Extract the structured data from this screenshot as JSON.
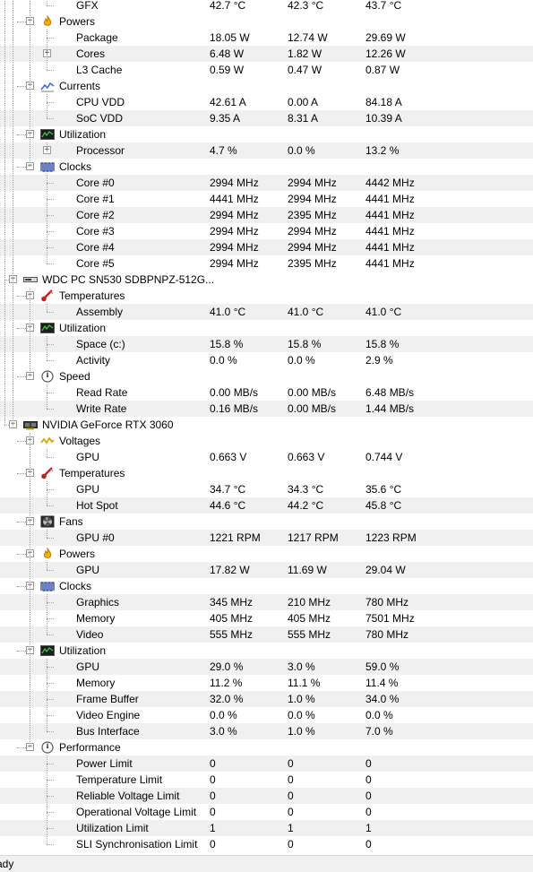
{
  "tree": [
    {
      "kind": "leaf",
      "depth": 3,
      "label": "GFX",
      "v": [
        "42.7 °C",
        "42.3 °C",
        "43.7 °C"
      ]
    },
    {
      "kind": "group",
      "depth": 2,
      "icon": "flame",
      "label": "Powers"
    },
    {
      "kind": "leaf",
      "depth": 3,
      "label": "Package",
      "v": [
        "18.05 W",
        "12.74 W",
        "29.69 W"
      ]
    },
    {
      "kind": "leaf",
      "depth": 3,
      "label": "Cores",
      "expander": true,
      "v": [
        "6.48 W",
        "1.82 W",
        "12.26 W"
      ]
    },
    {
      "kind": "leaf",
      "depth": 3,
      "label": "L3 Cache",
      "v": [
        "0.59 W",
        "0.47 W",
        "0.87 W"
      ]
    },
    {
      "kind": "group",
      "depth": 2,
      "icon": "current",
      "label": "Currents"
    },
    {
      "kind": "leaf",
      "depth": 3,
      "label": "CPU VDD",
      "v": [
        "42.61 A",
        "0.00 A",
        "84.18 A"
      ]
    },
    {
      "kind": "leaf",
      "depth": 3,
      "label": "SoC VDD",
      "v": [
        "9.35 A",
        "8.31 A",
        "10.39 A"
      ]
    },
    {
      "kind": "group",
      "depth": 2,
      "icon": "monitor",
      "label": "Utilization"
    },
    {
      "kind": "leaf",
      "depth": 3,
      "label": "Processor",
      "expander": true,
      "v": [
        "4.7 %",
        "0.0 %",
        "13.2 %"
      ]
    },
    {
      "kind": "group",
      "depth": 2,
      "icon": "clock",
      "label": "Clocks"
    },
    {
      "kind": "leaf",
      "depth": 3,
      "label": "Core #0",
      "v": [
        "2994 MHz",
        "2994 MHz",
        "4442 MHz"
      ]
    },
    {
      "kind": "leaf",
      "depth": 3,
      "label": "Core #1",
      "v": [
        "4441 MHz",
        "2994 MHz",
        "4441 MHz"
      ]
    },
    {
      "kind": "leaf",
      "depth": 3,
      "label": "Core #2",
      "v": [
        "2994 MHz",
        "2395 MHz",
        "4441 MHz"
      ]
    },
    {
      "kind": "leaf",
      "depth": 3,
      "label": "Core #3",
      "v": [
        "2994 MHz",
        "2994 MHz",
        "4441 MHz"
      ]
    },
    {
      "kind": "leaf",
      "depth": 3,
      "label": "Core #4",
      "v": [
        "2994 MHz",
        "2994 MHz",
        "4441 MHz"
      ]
    },
    {
      "kind": "leaf",
      "depth": 3,
      "label": "Core #5",
      "v": [
        "2994 MHz",
        "2395 MHz",
        "4441 MHz"
      ]
    },
    {
      "kind": "group",
      "depth": 1,
      "icon": "drive",
      "label": "WDC PC SN530 SDBPNPZ-512G..."
    },
    {
      "kind": "group",
      "depth": 2,
      "icon": "thermo",
      "label": "Temperatures"
    },
    {
      "kind": "leaf",
      "depth": 3,
      "label": "Assembly",
      "v": [
        "41.0 °C",
        "41.0 °C",
        "41.0 °C"
      ]
    },
    {
      "kind": "group",
      "depth": 2,
      "icon": "monitor",
      "label": "Utilization"
    },
    {
      "kind": "leaf",
      "depth": 3,
      "label": "Space (c:)",
      "v": [
        "15.8 %",
        "15.8 %",
        "15.8 %"
      ]
    },
    {
      "kind": "leaf",
      "depth": 3,
      "label": "Activity",
      "v": [
        "0.0 %",
        "0.0 %",
        "2.9 %"
      ]
    },
    {
      "kind": "group",
      "depth": 2,
      "icon": "gauge",
      "label": "Speed"
    },
    {
      "kind": "leaf",
      "depth": 3,
      "label": "Read Rate",
      "v": [
        "0.00 MB/s",
        "0.00 MB/s",
        "6.48 MB/s"
      ]
    },
    {
      "kind": "leaf",
      "depth": 3,
      "label": "Write Rate",
      "v": [
        "0.16 MB/s",
        "0.00 MB/s",
        "1.44 MB/s"
      ]
    },
    {
      "kind": "group",
      "depth": 1,
      "icon": "gpu",
      "label": "NVIDIA GeForce RTX 3060"
    },
    {
      "kind": "group",
      "depth": 2,
      "icon": "voltage",
      "label": "Voltages"
    },
    {
      "kind": "leaf",
      "depth": 3,
      "label": "GPU",
      "v": [
        "0.663 V",
        "0.663 V",
        "0.744 V"
      ]
    },
    {
      "kind": "group",
      "depth": 2,
      "icon": "thermo",
      "label": "Temperatures"
    },
    {
      "kind": "leaf",
      "depth": 3,
      "label": "GPU",
      "v": [
        "34.7 °C",
        "34.3 °C",
        "35.6 °C"
      ]
    },
    {
      "kind": "leaf",
      "depth": 3,
      "label": "Hot Spot",
      "v": [
        "44.6 °C",
        "44.2 °C",
        "45.8 °C"
      ]
    },
    {
      "kind": "group",
      "depth": 2,
      "icon": "fan",
      "label": "Fans"
    },
    {
      "kind": "leaf",
      "depth": 3,
      "label": "GPU #0",
      "v": [
        "1221 RPM",
        "1217 RPM",
        "1223 RPM"
      ]
    },
    {
      "kind": "group",
      "depth": 2,
      "icon": "flame",
      "label": "Powers"
    },
    {
      "kind": "leaf",
      "depth": 3,
      "label": "GPU",
      "v": [
        "17.82 W",
        "11.69 W",
        "29.04 W"
      ]
    },
    {
      "kind": "group",
      "depth": 2,
      "icon": "clock",
      "label": "Clocks"
    },
    {
      "kind": "leaf",
      "depth": 3,
      "label": "Graphics",
      "v": [
        "345 MHz",
        "210 MHz",
        "780 MHz"
      ]
    },
    {
      "kind": "leaf",
      "depth": 3,
      "label": "Memory",
      "v": [
        "405 MHz",
        "405 MHz",
        "7501 MHz"
      ]
    },
    {
      "kind": "leaf",
      "depth": 3,
      "label": "Video",
      "v": [
        "555 MHz",
        "555 MHz",
        "780 MHz"
      ]
    },
    {
      "kind": "group",
      "depth": 2,
      "icon": "monitor",
      "label": "Utilization"
    },
    {
      "kind": "leaf",
      "depth": 3,
      "label": "GPU",
      "v": [
        "29.0 %",
        "3.0 %",
        "59.0 %"
      ]
    },
    {
      "kind": "leaf",
      "depth": 3,
      "label": "Memory",
      "v": [
        "11.2 %",
        "11.1 %",
        "11.4 %"
      ]
    },
    {
      "kind": "leaf",
      "depth": 3,
      "label": "Frame Buffer",
      "v": [
        "32.0 %",
        "1.0 %",
        "34.0 %"
      ]
    },
    {
      "kind": "leaf",
      "depth": 3,
      "label": "Video Engine",
      "v": [
        "0.0 %",
        "0.0 %",
        "0.0 %"
      ]
    },
    {
      "kind": "leaf",
      "depth": 3,
      "label": "Bus Interface",
      "v": [
        "3.0 %",
        "1.0 %",
        "7.0 %"
      ]
    },
    {
      "kind": "group",
      "depth": 2,
      "icon": "gauge",
      "label": "Performance"
    },
    {
      "kind": "leaf",
      "depth": 3,
      "label": "Power Limit",
      "v": [
        "0",
        "0",
        "0"
      ]
    },
    {
      "kind": "leaf",
      "depth": 3,
      "label": "Temperature Limit",
      "v": [
        "0",
        "0",
        "0"
      ]
    },
    {
      "kind": "leaf",
      "depth": 3,
      "label": "Reliable Voltage Limit",
      "v": [
        "0",
        "0",
        "0"
      ]
    },
    {
      "kind": "leaf",
      "depth": 3,
      "label": "Operational Voltage Limit",
      "v": [
        "0",
        "0",
        "0"
      ]
    },
    {
      "kind": "leaf",
      "depth": 3,
      "label": "Utilization Limit",
      "v": [
        "1",
        "1",
        "1"
      ]
    },
    {
      "kind": "leaf",
      "depth": 3,
      "label": "SLI Synchronisation Limit",
      "v": [
        "0",
        "0",
        "0"
      ]
    }
  ],
  "status": {
    "text": "ady"
  },
  "colors": {
    "alt_row": "#f0f0f0",
    "tree_line": "#a0a0a0",
    "flame": "#e8a000",
    "thermo": "#c81e1e",
    "current": "#3a6fd8",
    "monitor_screen": "#1a7a1a",
    "clock": "#1f3fa0"
  }
}
